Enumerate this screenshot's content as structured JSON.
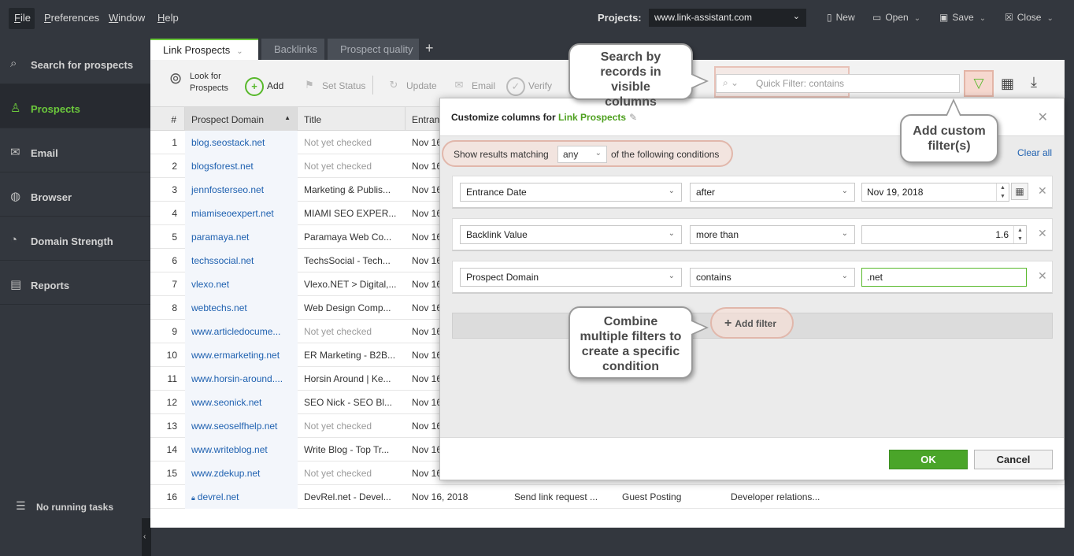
{
  "menu": {
    "items": [
      {
        "label": "File",
        "underline": "F",
        "rest": "ile"
      },
      {
        "label": "Preferences",
        "underline": "P",
        "rest": "references"
      },
      {
        "label": "Window",
        "underline": "W",
        "rest": "indow"
      },
      {
        "label": "Help",
        "underline": "H",
        "rest": "elp"
      }
    ],
    "projects_label": "Projects:",
    "project_value": "www.link-assistant.com",
    "buttons": {
      "new": "New",
      "open": "Open",
      "save": "Save",
      "close": "Close"
    }
  },
  "sidebar": {
    "items": [
      {
        "label": "Search for prospects",
        "icon": "search-icon"
      },
      {
        "label": "Prospects",
        "icon": "user-icon",
        "active": true
      },
      {
        "label": "Email",
        "icon": "mail-icon"
      },
      {
        "label": "Browser",
        "icon": "globe-icon"
      },
      {
        "label": "Domain Strength",
        "icon": "gauge-icon"
      },
      {
        "label": "Reports",
        "icon": "report-icon"
      }
    ],
    "footer": "No running tasks",
    "accent_color": "#6cc93c"
  },
  "tabs": {
    "items": [
      "Link Prospects",
      "Backlinks",
      "Prospect quality"
    ],
    "add": "+"
  },
  "toolbar": {
    "look_line1": "Look for",
    "look_line2": "Prospects",
    "add": "Add",
    "set_status": "Set Status",
    "update": "Update",
    "email": "Email",
    "verify": "Verify",
    "quick_filter_placeholder": "Quick Filter: contains"
  },
  "table": {
    "headers": [
      "#",
      "Prospect Domain",
      "Title",
      "Entranc"
    ],
    "rows": [
      {
        "n": "1",
        "domain": "blog.seostack.net",
        "title": "Not yet checked",
        "muted": true,
        "date": "Nov 16"
      },
      {
        "n": "2",
        "domain": "blogsforest.net",
        "title": "Not yet checked",
        "muted": true,
        "date": "Nov 16"
      },
      {
        "n": "3",
        "domain": "jennfosterseo.net",
        "title": "Marketing & Publis...",
        "muted": false,
        "date": "Nov 16"
      },
      {
        "n": "4",
        "domain": "miamiseoexpert.net",
        "title": "MIAMI SEO EXPER...",
        "muted": false,
        "date": "Nov 16"
      },
      {
        "n": "5",
        "domain": "paramaya.net",
        "title": "Paramaya Web Co...",
        "muted": false,
        "date": "Nov 16"
      },
      {
        "n": "6",
        "domain": "techssocial.net",
        "title": "TechsSocial - Tech...",
        "muted": false,
        "date": "Nov 16"
      },
      {
        "n": "7",
        "domain": "vlexo.net",
        "title": "Vlexo.NET > Digital,...",
        "muted": false,
        "date": "Nov 16"
      },
      {
        "n": "8",
        "domain": "webtechs.net",
        "title": "Web Design Comp...",
        "muted": false,
        "date": "Nov 16"
      },
      {
        "n": "9",
        "domain": "www.articledocume...",
        "title": "Not yet checked",
        "muted": true,
        "date": "Nov 16"
      },
      {
        "n": "10",
        "domain": "www.ermarketing.net",
        "title": "ER Marketing - B2B...",
        "muted": false,
        "date": "Nov 16"
      },
      {
        "n": "11",
        "domain": "www.horsin-around....",
        "title": "Horsin Around | Ke...",
        "muted": false,
        "date": "Nov 16"
      },
      {
        "n": "12",
        "domain": "www.seonick.net",
        "title": "SEO Nick - SEO Bl...",
        "muted": false,
        "date": "Nov 16"
      },
      {
        "n": "13",
        "domain": "www.seoselfhelp.net",
        "title": "Not yet checked",
        "muted": true,
        "date": "Nov 16"
      },
      {
        "n": "14",
        "domain": "www.writeblog.net",
        "title": "Write Blog - Top Tr...",
        "muted": false,
        "date": "Nov 16"
      },
      {
        "n": "15",
        "domain": "www.zdekup.net",
        "title": "Not yet checked",
        "muted": true,
        "date": "Nov 16"
      },
      {
        "n": "16",
        "domain": "devrel.net",
        "title": "DevRel.net - Devel...",
        "muted": false,
        "date": "Nov 16, 2018",
        "lock": true,
        "c5": "Send link request ...",
        "c6": "Guest Posting",
        "c7": "Developer relations..."
      }
    ]
  },
  "dialog": {
    "title_prefix": "Customize columns for",
    "title_project": "Link Prospects",
    "show_results": "Show results matching",
    "match_value": "any",
    "conditions_suffix": "of the following conditions",
    "clear_all": "Clear all",
    "conditions": [
      {
        "field": "Entrance Date",
        "op": "after",
        "value": "Nov 19, 2018"
      },
      {
        "field": "Backlink Value",
        "op": "more than",
        "value": "1.6"
      },
      {
        "field": "Prospect Domain",
        "op": "contains",
        "value": ".net"
      }
    ],
    "add_filter": "Add filter",
    "ok": "OK",
    "cancel": "Cancel"
  },
  "callouts": {
    "search": "Search by records in visible columns",
    "custom": "Add custom filter(s)",
    "combine": "Combine multiple filters to create a specific condition"
  }
}
